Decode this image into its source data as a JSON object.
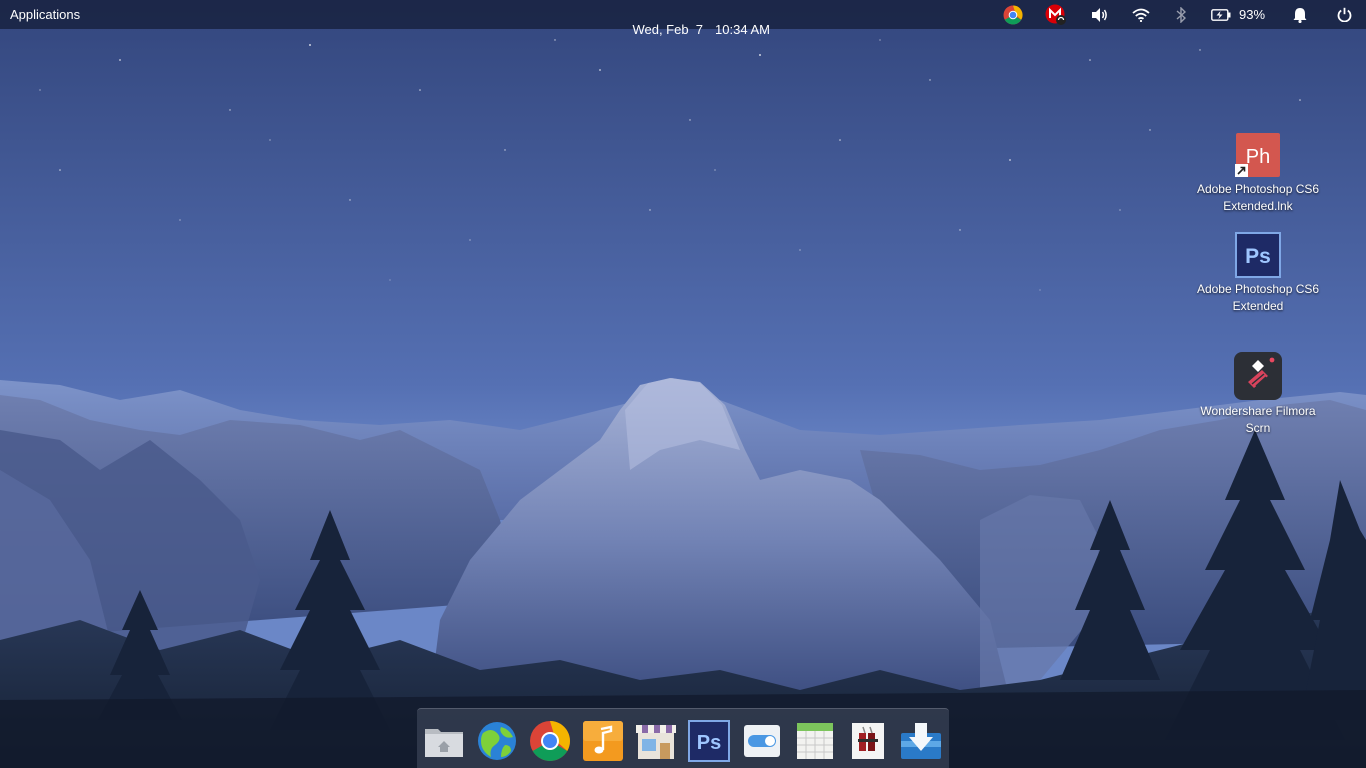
{
  "panel": {
    "applications_label": "Applications",
    "date": "Wed, Feb  7",
    "time": "10:34 AM",
    "battery_percent": "93%",
    "indicators": [
      "chrome-icon",
      "mega-sync-icon",
      "volume-icon",
      "wifi-icon",
      "bluetooth-icon",
      "battery-icon",
      "notifications-bell-icon",
      "power-icon"
    ]
  },
  "desktop": {
    "icons": [
      {
        "label": "Adobe Photoshop CS6 Extended.lnk",
        "line1": "Adobe Photoshop CS6",
        "line2": "Extended.lnk",
        "icon": "photoshop-shortcut-icon",
        "glyph": "Ph",
        "color": "#d3574f"
      },
      {
        "label": "Adobe Photoshop CS6 Extended",
        "line1": "Adobe Photoshop CS6",
        "line2": "Extended",
        "icon": "photoshop-icon",
        "glyph": "Ps",
        "color": "#1e2a66"
      },
      {
        "label": "Wondershare Filmora Scrn",
        "line1": "Wondershare Filmora",
        "line2": "Scrn",
        "icon": "filmora-scrn-icon",
        "color": "#2c2f36"
      }
    ]
  },
  "dock": {
    "items": [
      {
        "name": "files",
        "icon": "home-folder-icon",
        "running": true
      },
      {
        "name": "web-browser",
        "icon": "epiphany-icon",
        "running": false
      },
      {
        "name": "chrome",
        "icon": "chrome-icon",
        "running": true
      },
      {
        "name": "music",
        "icon": "music-icon",
        "running": false
      },
      {
        "name": "appcenter",
        "icon": "appcenter-icon",
        "running": false
      },
      {
        "name": "photoshop",
        "icon": "photoshop-icon",
        "glyph": "Ps",
        "running": false
      },
      {
        "name": "system-settings",
        "icon": "settings-toggle-icon",
        "running": false
      },
      {
        "name": "calendar",
        "icon": "calendar-icon",
        "running": false
      },
      {
        "name": "archive-tool",
        "icon": "archive-icon",
        "running": false
      },
      {
        "name": "installer",
        "icon": "download-installer-icon",
        "running": true
      }
    ]
  },
  "colors": {
    "panel_bg": "#141c34",
    "accent_dot": "#4da3ff",
    "sky_top": "#3a4f86",
    "sky_horizon": "#6a86c6"
  }
}
